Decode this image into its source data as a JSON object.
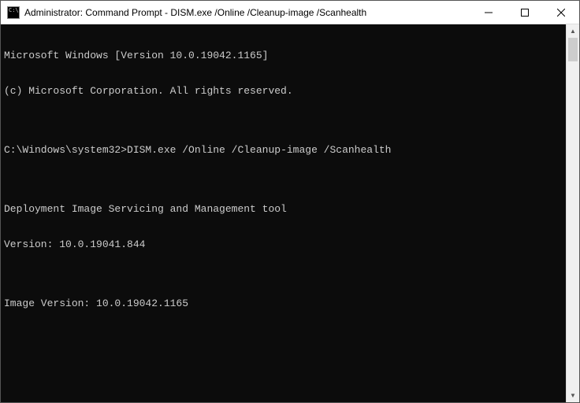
{
  "window": {
    "title": "Administrator: Command Prompt - DISM.exe  /Online /Cleanup-image /Scanhealth",
    "icon_text": "C:\\."
  },
  "controls": {
    "minimize": "minimize",
    "maximize": "maximize",
    "close": "close"
  },
  "terminal": {
    "lines": [
      "Microsoft Windows [Version 10.0.19042.1165]",
      "(c) Microsoft Corporation. All rights reserved.",
      "",
      "",
      "",
      "Deployment Image Servicing and Management tool",
      "Version: 10.0.19041.844",
      "",
      "Image Version: 10.0.19042.1165",
      ""
    ],
    "prompt": "C:\\Windows\\system32>",
    "command": "DISM.exe /Online /Cleanup-image /Scanhealth"
  }
}
